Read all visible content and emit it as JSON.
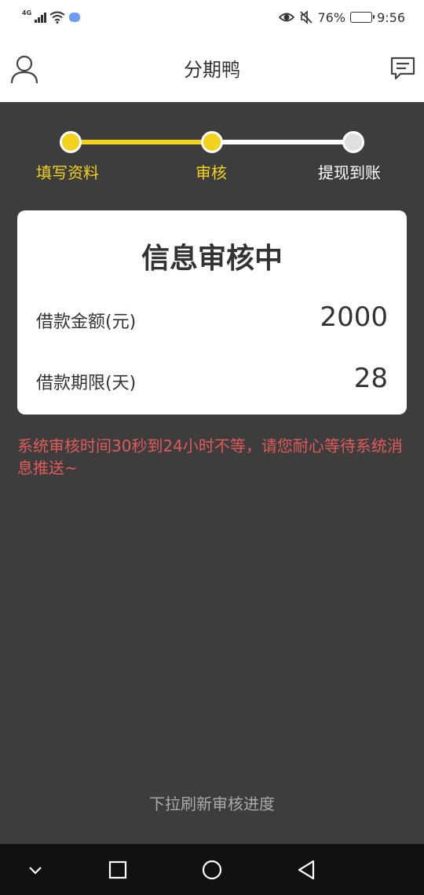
{
  "status_bar": {
    "network": "4G",
    "battery": "76%",
    "battery_level": 0.76,
    "time": "9:56"
  },
  "header": {
    "title": "分期鸭",
    "left_icon": "user-icon",
    "right_icon": "message-icon"
  },
  "steps": [
    {
      "label": "填写资料",
      "state": "done"
    },
    {
      "label": "审核",
      "state": "current"
    },
    {
      "label": "提现到账",
      "state": "pending"
    }
  ],
  "card": {
    "title": "信息审核中",
    "amount_label": "借款金额(元)",
    "amount_value": "2000",
    "term_label": "借款期限(天)",
    "term_value": "28"
  },
  "notice": "系统审核时间30秒到24小时不等，请您耐心等待系统消息推送~",
  "refresh_hint": "下拉刷新审核进度",
  "nav": {
    "icons": [
      "chevron-down-icon",
      "square-icon",
      "circle-icon",
      "back-triangle-icon"
    ]
  },
  "colors": {
    "accent": "#f2d21c",
    "background": "#3d3d3d",
    "pending": "#e0e0e0",
    "notice": "#e05a5a"
  }
}
